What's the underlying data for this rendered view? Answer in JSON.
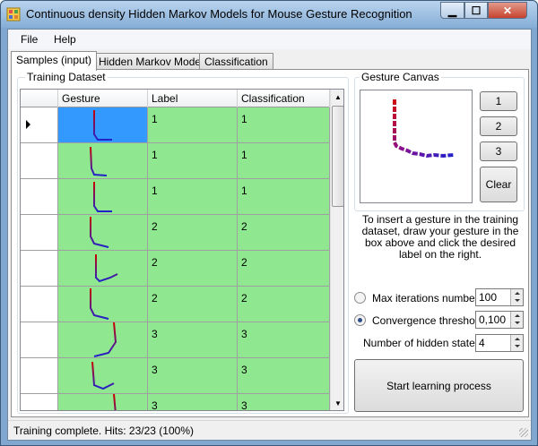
{
  "window": {
    "title": "Continuous density Hidden Markov Models for Mouse Gesture Recognition"
  },
  "menu": {
    "file": "File",
    "help": "Help"
  },
  "tabs": [
    "Samples (input)",
    "Hidden Markov Models",
    "Classification"
  ],
  "training": {
    "group_label": "Training Dataset",
    "columns": [
      "Gesture",
      "Label",
      "Classification"
    ],
    "rows": [
      {
        "label": "1",
        "classification": "1",
        "selected": true
      },
      {
        "label": "1",
        "classification": "1"
      },
      {
        "label": "1",
        "classification": "1"
      },
      {
        "label": "2",
        "classification": "2"
      },
      {
        "label": "2",
        "classification": "2"
      },
      {
        "label": "2",
        "classification": "2"
      },
      {
        "label": "3",
        "classification": "3"
      },
      {
        "label": "3",
        "classification": "3"
      },
      {
        "label": "3",
        "classification": "3"
      }
    ]
  },
  "canvas": {
    "group_label": "Gesture Canvas",
    "buttons": {
      "b1": "1",
      "b2": "2",
      "b3": "3",
      "clear": "Clear"
    }
  },
  "instructions": "To insert a gesture in the training dataset, draw your gesture in the box above and click the desired label on the right.",
  "options": {
    "max_iterations": {
      "label": "Max iterations number",
      "value": "100",
      "selected": false
    },
    "convergence": {
      "label": "Convergence threshold",
      "value": "0,100",
      "selected": true
    },
    "hidden_states": {
      "label": "Number of hidden states:",
      "value": "4"
    }
  },
  "start_button": "Start learning process",
  "status": "Training complete. Hits: 23/23 (100%)",
  "colors": {
    "row_green": "#8fe88f",
    "row_selected": "#3399ff",
    "stroke_start": "#cc0000",
    "stroke_end": "#2222cc"
  }
}
